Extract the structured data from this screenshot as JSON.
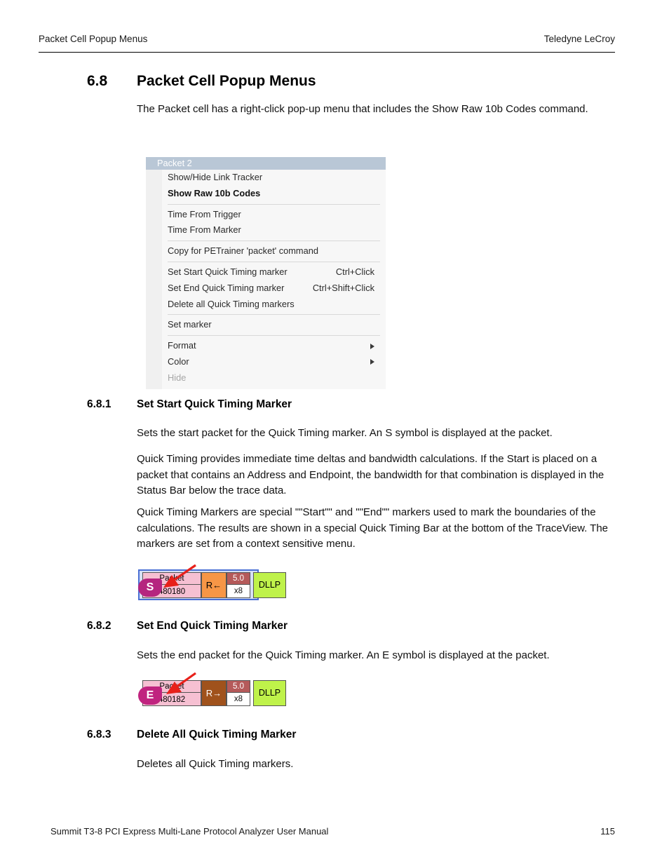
{
  "header": {
    "left": "Packet Cell Popup Menus",
    "right": "Teledyne LeCroy"
  },
  "section": {
    "number": "6.8",
    "title": "Packet Cell Popup Menus",
    "intro": "The Packet cell has a right-click pop-up menu that includes the Show Raw 10b Codes command."
  },
  "context_menu": {
    "title": "Packet 2",
    "items": [
      {
        "label": "Show/Hide Link Tracker",
        "accel": "",
        "bold": false,
        "disabled": false,
        "submenu": false
      },
      {
        "label": "Show Raw 10b Codes",
        "accel": "",
        "bold": true,
        "disabled": false,
        "submenu": false
      },
      {
        "separator": true
      },
      {
        "label": "Time From Trigger",
        "accel": "",
        "bold": false,
        "disabled": false,
        "submenu": false
      },
      {
        "label": "Time From Marker",
        "accel": "",
        "bold": false,
        "disabled": false,
        "submenu": false
      },
      {
        "separator": true
      },
      {
        "label": "Copy for PETrainer 'packet' command",
        "accel": "",
        "bold": false,
        "disabled": false,
        "submenu": false
      },
      {
        "separator": true
      },
      {
        "label": "Set Start Quick Timing marker",
        "accel": "Ctrl+Click",
        "bold": false,
        "disabled": false,
        "submenu": false
      },
      {
        "label": "Set End Quick Timing marker",
        "accel": "Ctrl+Shift+Click",
        "bold": false,
        "disabled": false,
        "submenu": false
      },
      {
        "label": "Delete all Quick Timing markers",
        "accel": "",
        "bold": false,
        "disabled": false,
        "submenu": false
      },
      {
        "separator": true
      },
      {
        "label": "Set marker",
        "accel": "",
        "bold": false,
        "disabled": false,
        "submenu": false
      },
      {
        "separator": true
      },
      {
        "label": "Format",
        "accel": "",
        "bold": false,
        "disabled": false,
        "submenu": true
      },
      {
        "label": "Color",
        "accel": "",
        "bold": false,
        "disabled": false,
        "submenu": true
      },
      {
        "label": "Hide",
        "accel": "",
        "bold": false,
        "disabled": true,
        "submenu": false
      }
    ]
  },
  "subsections": [
    {
      "number": "6.8.1",
      "title": "Set Start Quick Timing Marker",
      "paragraphs": [
        "Sets the start packet for the Quick Timing marker. An S symbol is displayed at the packet.",
        "Quick Timing provides immediate time deltas and bandwidth calculations. If the Start is placed on a packet that contains an Address and Endpoint, the bandwidth for that combination is displayed in the Status Bar below the trace data.",
        "Quick Timing Markers are special \"\"Start\"\" and \"\"End\"\" markers used to mark the boundaries of the calculations. The results are shown in a special Quick Timing Bar at the bottom of the TraceView. The markers are set from a context sensitive menu."
      ]
    },
    {
      "number": "6.8.2",
      "title": "Set End Quick Timing Marker",
      "paragraphs": [
        "Sets the end packet for the Quick Timing marker. An E symbol is displayed at the packet."
      ]
    },
    {
      "number": "6.8.3",
      "title": "Delete All Quick Timing Marker",
      "paragraphs": [
        "Deletes all Quick Timing markers."
      ]
    }
  ],
  "trace_start": {
    "badge": "S",
    "packet_label": "Packet",
    "packet_number": "480180",
    "direction": "R←",
    "speed": "5.0",
    "width": "x8",
    "packet_type": "DLLP"
  },
  "trace_end": {
    "badge": "E",
    "packet_label": "Packet",
    "packet_number": "480182",
    "direction": "R→",
    "speed": "5.0",
    "width": "x8",
    "packet_type": "DLLP"
  },
  "footer": {
    "left": "Summit T3-8 PCI Express Multi-Lane Protocol Analyzer User Manual",
    "page": "115"
  },
  "colors": {
    "menu_title_bar": "#b9c7d6",
    "menu_body": "#f7f7f7",
    "packet_cell": "#f6c0d2",
    "direction_rx": "#f79646",
    "direction_tx": "#a0521c",
    "speed_band": "#b55a5a",
    "packet_type": "#bff24a",
    "badge": "#b5257f",
    "selection_frame": "#4a6fd4",
    "arrow": "#e8201a"
  }
}
